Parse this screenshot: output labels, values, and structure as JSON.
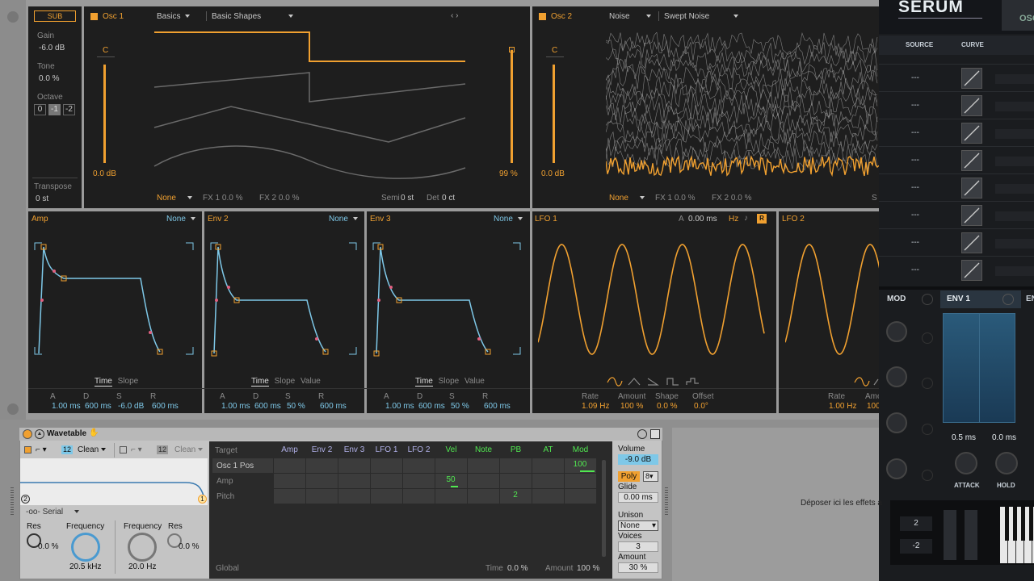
{
  "osc1": {
    "sub_label": "SUB",
    "gain_label": "Gain",
    "gain_value": "-6.0 dB",
    "tone_label": "Tone",
    "tone_value": "0.0 %",
    "octave_label": "Octave",
    "octave_options": [
      "0",
      "-1",
      "-2"
    ],
    "transpose_label": "Transpose",
    "transpose_value": "0 st",
    "name": "Osc 1",
    "category": "Basics",
    "wavetable": "Basic Shapes",
    "left_slider_label": "C",
    "left_slider_value": "0.0 dB",
    "right_slider_value": "99 %",
    "mod_source": "None",
    "fx1": "FX 1 0.0 %",
    "fx2": "FX 2 0.0 %",
    "semi_label": "Semi",
    "semi_value": "0 st",
    "det_label": "Det",
    "det_value": "0 ct",
    "nav": "‹ ›"
  },
  "osc2": {
    "name": "Osc 2",
    "category": "Noise",
    "wavetable": "Swept Noise",
    "left_slider_label": "C",
    "left_slider_value": "0.0 dB",
    "mod_source": "None",
    "fx1": "FX 1 0.0 %",
    "fx2": "FX 2 0.0 %",
    "trailing": "S"
  },
  "envs": [
    {
      "name": "Amp",
      "mod": "None",
      "tabs": [
        "Time",
        "Slope"
      ],
      "a": "1.00 ms",
      "d": "600 ms",
      "s": "-6.0 dB",
      "r": "600 ms"
    },
    {
      "name": "Env 2",
      "mod": "None",
      "tabs": [
        "Time",
        "Slope",
        "Value"
      ],
      "a": "1.00 ms",
      "d": "600 ms",
      "s": "50 %",
      "r": "600 ms"
    },
    {
      "name": "Env 3",
      "mod": "None",
      "tabs": [
        "Time",
        "Slope",
        "Value"
      ],
      "a": "1.00 ms",
      "d": "600 ms",
      "s": "50 %",
      "r": "600 ms"
    }
  ],
  "env_param_labels": [
    "A",
    "D",
    "S",
    "R"
  ],
  "lfo1": {
    "name": "LFO 1",
    "a_label": "A",
    "a_value": "0.00 ms",
    "unit": "Hz",
    "r_badge": "R",
    "rate_label": "Rate",
    "rate_value": "1.09 Hz",
    "amount_label": "Amount",
    "amount_value": "100 %",
    "shape_label": "Shape",
    "shape_value": "0.0 %",
    "offset_label": "Offset",
    "offset_value": "0.0°"
  },
  "lfo2": {
    "name": "LFO 2",
    "rate_label": "Rate",
    "rate_value": "1.00 Hz",
    "amount_label": "Amo",
    "amount_value": "100"
  },
  "serum": {
    "logo": "SERUM",
    "top_right": "OSC",
    "source_header": "SOURCE",
    "curve_header": "CURVE",
    "slot_placeholder": "---",
    "mod_tab": "MOD",
    "env1_tab": "ENV 1",
    "env_next": "EN",
    "attack_value": "0.5",
    "attack_unit": "ms",
    "hold_value": "0.0",
    "hold_unit": "ms",
    "attack_label": "ATTACK",
    "hold_label": "HOLD",
    "stepper1": "2",
    "stepper2": "-2"
  },
  "wavetable_device": {
    "title": "Wavetable",
    "filter1_num": "12",
    "filter1_type": "Clean",
    "filter2_num": "12",
    "filter2_type": "Clean",
    "routing": "Serial",
    "res_label": "Res",
    "res_value": "0.0 %",
    "freq_label": "Frequency",
    "freq_value": "20.5 kHz",
    "freq2_label": "Frequency",
    "freq2_value": "20.0 Hz",
    "res2_label": "Res",
    "res2_value": "0.0 %",
    "node_left": "2",
    "node_right": "1"
  },
  "matrix": {
    "target_label": "Target",
    "columns": [
      "Amp",
      "Env 2",
      "Env 3",
      "LFO 1",
      "LFO 2",
      "Vel",
      "Note",
      "PB",
      "AT",
      "Mod"
    ],
    "rows": [
      "Osc 1 Pos",
      "Amp",
      "Pitch"
    ],
    "values": {
      "osc1pos_mod": "100",
      "amp_vel": "50",
      "pitch_pb": "2"
    },
    "global_label": "Global",
    "time_label": "Time",
    "time_value": "0.0 %",
    "amount_label": "Amount",
    "amount_value": "100 %"
  },
  "voice": {
    "volume_label": "Volume",
    "volume_value": "-9.0 dB",
    "poly_label": "Poly",
    "poly_count": "8",
    "glide_label": "Glide",
    "glide_value": "0.00 ms",
    "unison_label": "Unison",
    "unison_value": "None",
    "voices_label": "Voices",
    "voices_value": "3",
    "amount_label": "Amount",
    "amount_value": "30 %"
  },
  "drop_zone": "Déposer ici les effets a",
  "colors": {
    "accent": "#f0a030",
    "env_blue": "#7ec8e8",
    "panel": "#1e1e1e"
  }
}
